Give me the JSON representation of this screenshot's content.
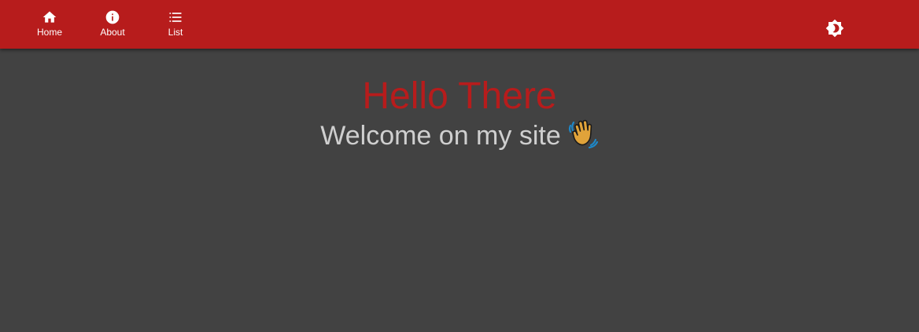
{
  "nav": {
    "items": [
      {
        "label": "Home",
        "icon": "home-icon"
      },
      {
        "label": "About",
        "icon": "info-icon"
      },
      {
        "label": "List",
        "icon": "list-icon"
      }
    ]
  },
  "toolbar": {
    "theme_toggle_icon": "brightness-icon"
  },
  "main": {
    "title": "Hello There",
    "subtitle": "Welcome on my site",
    "subtitle_emoji": "waving-hand-icon"
  },
  "colors": {
    "appbar": "#b71c1c",
    "background": "#424242",
    "title": "#b71c1c",
    "subtitle": "#cfcfcf"
  }
}
